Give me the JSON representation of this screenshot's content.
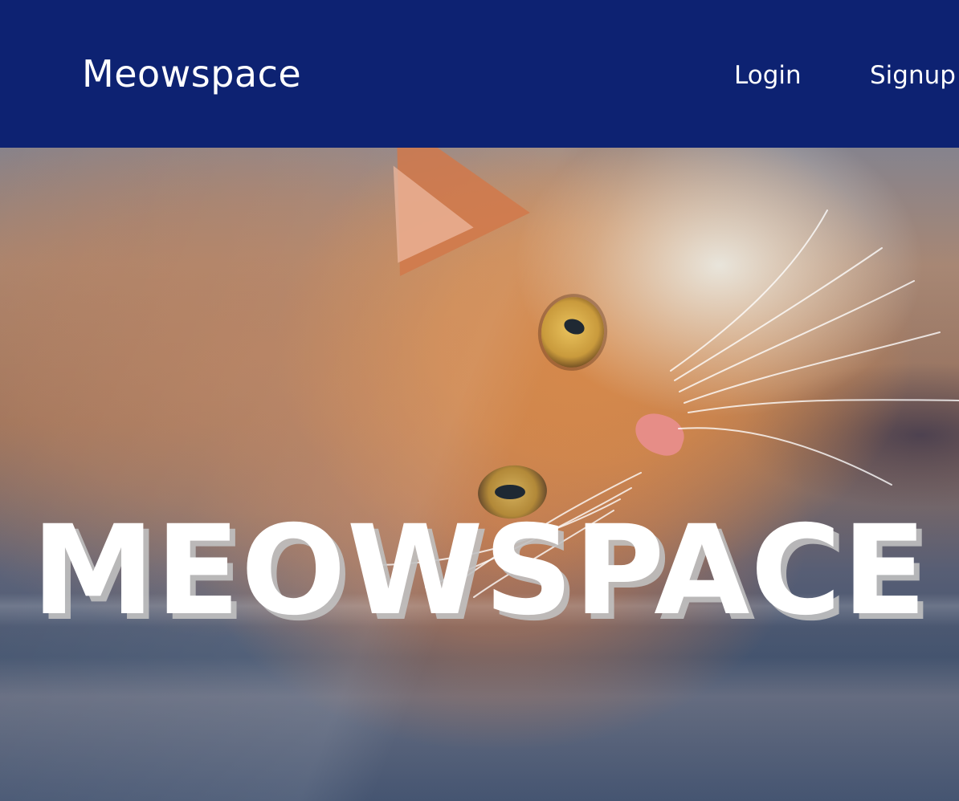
{
  "navbar": {
    "brand": "Meowspace",
    "links": [
      {
        "label": "Login"
      },
      {
        "label": "Signup"
      }
    ],
    "background_color": "#0d2272",
    "text_color": "#ffffff"
  },
  "hero": {
    "title": "MEOWSPACE",
    "image_subject": "orange tabby cat lying on floor",
    "title_color": "#ffffff",
    "title_shadow_color": "#c0c0c0"
  }
}
